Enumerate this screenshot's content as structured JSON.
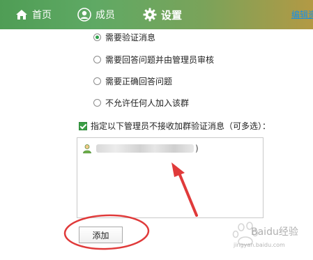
{
  "nav": {
    "home_label": "首页",
    "members_label": "成员",
    "settings_label": "设置",
    "edit_label": "编辑资料"
  },
  "verification_options": [
    {
      "label": "需要验证消息",
      "selected": true
    },
    {
      "label": "需要回答问题并由管理员审核",
      "selected": false
    },
    {
      "label": "需要正确回答问题",
      "selected": false
    },
    {
      "label": "不允许任何人加入该群",
      "selected": false
    }
  ],
  "admin_exclusion": {
    "checked": true,
    "label": "指定以下管理员不接收加群验证消息（可多选）：",
    "entries": [
      {
        "name_suffix": ")"
      }
    ]
  },
  "add_button_label": "添加",
  "watermark": {
    "text": "Baidu经验",
    "sub": "jingyan.baidu.com"
  },
  "colors": {
    "topbar_start": "#4f9d55",
    "topbar_end": "#b39944",
    "accent_green": "#2da14a",
    "annotation_red": "#e03a3a",
    "link_blue": "#1a8fe6"
  }
}
